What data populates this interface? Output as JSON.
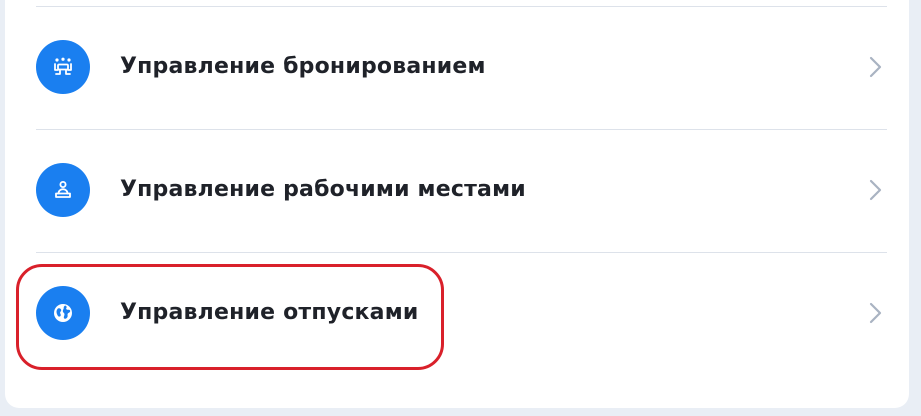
{
  "menu": {
    "items": [
      {
        "label": "Управление бронированием",
        "icon": "booking-people-icon"
      },
      {
        "label": "Управление рабочими местами",
        "icon": "workspace-icon"
      },
      {
        "label": "Управление отпусками",
        "icon": "globe-icon"
      }
    ]
  },
  "colors": {
    "accent": "#1a7ff0",
    "highlight": "#d9202a",
    "divider": "#dde2ea",
    "chevron": "#a9b3c2"
  }
}
